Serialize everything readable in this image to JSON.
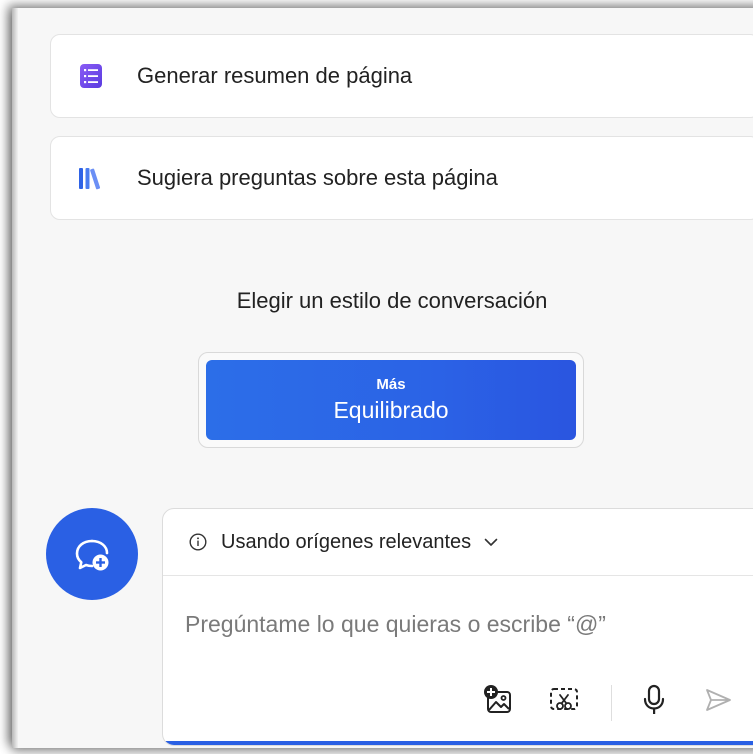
{
  "suggestions": [
    {
      "label": "Generar resumen de página",
      "icon": "list-document-icon"
    },
    {
      "label": "Sugiera preguntas sobre esta página",
      "icon": "books-icon"
    }
  ],
  "conversation_style": {
    "title": "Elegir un estilo de conversación",
    "selected_prefix": "Más",
    "selected_label": "Equilibrado"
  },
  "composer": {
    "sources_label": "Usando orígenes relevantes",
    "placeholder": "Pregúntame lo que quieras o escribe “@”"
  },
  "colors": {
    "accent": "#2a60e4",
    "list_icon": "#7b4ff0",
    "books_icon": "#3b6fe9"
  }
}
